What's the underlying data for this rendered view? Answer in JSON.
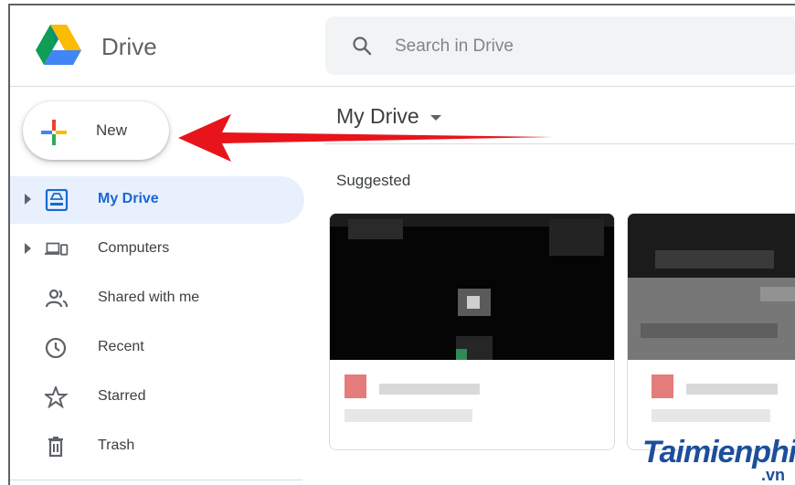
{
  "app": {
    "name": "Drive"
  },
  "search": {
    "placeholder": "Search in Drive"
  },
  "new_button": {
    "label": "New"
  },
  "sidebar": {
    "items": [
      {
        "label": "My Drive",
        "icon": "my-drive-icon",
        "active": true,
        "expandable": true
      },
      {
        "label": "Computers",
        "icon": "computers-icon",
        "active": false,
        "expandable": true
      },
      {
        "label": "Shared with me",
        "icon": "shared-with-me-icon",
        "active": false,
        "expandable": false
      },
      {
        "label": "Recent",
        "icon": "clock-icon",
        "active": false,
        "expandable": false
      },
      {
        "label": "Starred",
        "icon": "star-icon",
        "active": false,
        "expandable": false
      },
      {
        "label": "Trash",
        "icon": "trash-icon",
        "active": false,
        "expandable": false
      }
    ]
  },
  "main": {
    "title": "My Drive",
    "section": "Suggested"
  },
  "annotation": {
    "arrow_color": "#e8141b"
  },
  "colors": {
    "active_bg": "#e8f0fe",
    "active_text": "#1967d2",
    "search_bg": "#f1f3f4"
  },
  "watermark": {
    "text": "Taimienphi",
    "suffix": ".vn"
  }
}
